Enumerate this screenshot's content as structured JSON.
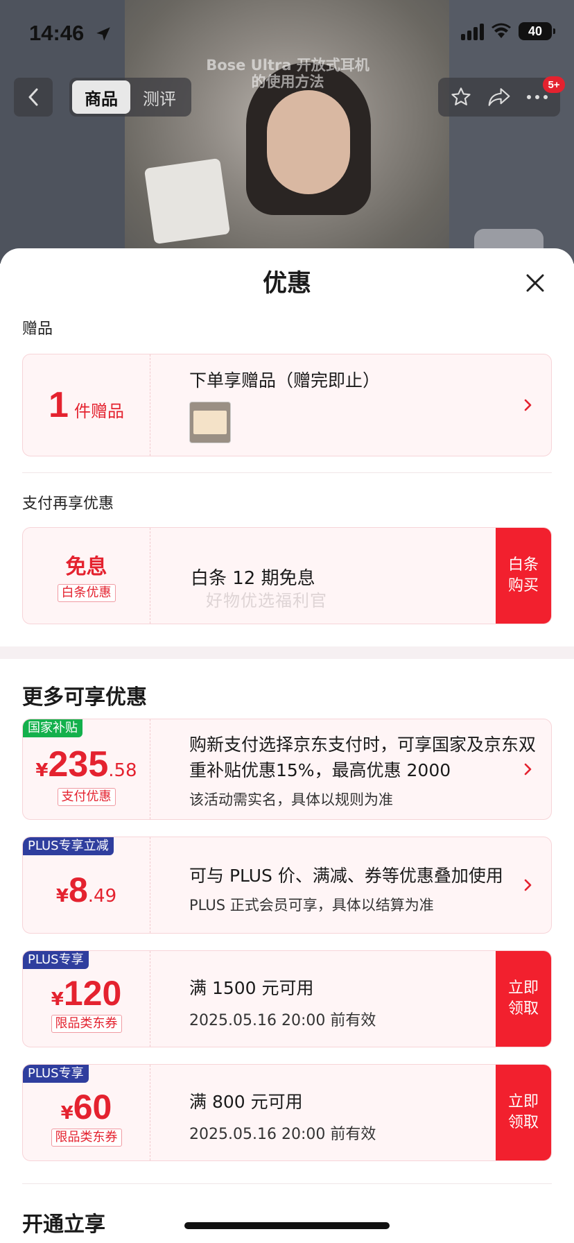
{
  "status_bar": {
    "time": "14:46",
    "battery": "40"
  },
  "video": {
    "caption_line1": "Bose Ultra 开放式耳机",
    "caption_line2": "的使用方法"
  },
  "nav": {
    "tab_goods": "商品",
    "tab_review": "测评",
    "badge": "5+"
  },
  "sheet": {
    "title": "优惠",
    "gift_section": {
      "label": "赠品",
      "count": "1",
      "count_unit": "件赠品",
      "desc": "下单享赠品（赠完即止）"
    },
    "pay_section": {
      "label": "支付再享优惠",
      "big_text": "免息",
      "tag": "白条优惠",
      "desc": "白条 12 期免息",
      "button": "白条\n购买"
    },
    "watermark": "好物优选福利官",
    "more_section": {
      "title": "更多可享优惠",
      "cards": [
        {
          "ribbon": "国家补贴",
          "currency": "¥",
          "price_int": "235",
          "price_dec": ".58",
          "tag": "支付优惠",
          "desc": "购新支付选择京东支付时，可享国家及京东双重补贴优惠15%，最高优惠 2000",
          "note": "该活动需实名，具体以规则为准"
        },
        {
          "ribbon": "PLUS专享立减",
          "currency": "¥",
          "price_int": "8",
          "price_dec": ".49",
          "desc": "可与 PLUS 价、满减、券等优惠叠加使用",
          "note": "PLUS 正式会员可享，具体以结算为准"
        },
        {
          "ribbon": "PLUS专享",
          "currency": "¥",
          "price_int": "120",
          "tag": "限品类东券",
          "desc": "满 1500 元可用",
          "note": "2025.05.16 20:00 前有效",
          "button": "立即\n领取"
        },
        {
          "ribbon": "PLUS专享",
          "currency": "¥",
          "price_int": "60",
          "tag": "限品类东券",
          "desc": "满 800 元可用",
          "note": "2025.05.16 20:00 前有效",
          "button": "立即\n领取"
        }
      ]
    },
    "bottom_title": "开通立享"
  },
  "colors": {
    "accent": "#e4222f",
    "button_red": "#f2202e",
    "green": "#13b04c",
    "plus_blue": "#2f3e9e"
  }
}
